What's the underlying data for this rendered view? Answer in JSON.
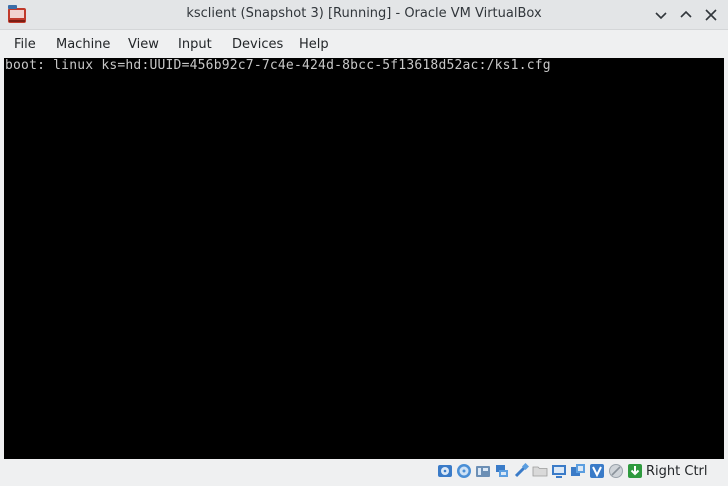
{
  "window": {
    "title": "ksclient (Snapshot 3) [Running] - Oracle VM VirtualBox",
    "buttons": [
      "minimize",
      "maximize",
      "close"
    ]
  },
  "menu": {
    "items": [
      "File",
      "Machine",
      "View",
      "Input",
      "Devices",
      "Help"
    ]
  },
  "console": {
    "line1": "boot: linux ks=hd:UUID=456b92c7-7c4e-424d-8bcc-5f13618d52ac:/ks1.cfg"
  },
  "statusbar": {
    "icons": [
      "hard-disk-icon",
      "optical-drive-icon",
      "audio-icon",
      "network-icon",
      "usb-icon",
      "shared-folders-icon",
      "display-icon",
      "video-capture-icon",
      "vt-x-icon",
      "mouse-integration-icon",
      "keyboard-capture-icon"
    ],
    "host_key": "Right Ctrl"
  },
  "colors": {
    "titlebar": "#e3e5e7",
    "menubar": "#eff0f1",
    "screen": "#000000",
    "console_text": "#c8c8c8"
  }
}
